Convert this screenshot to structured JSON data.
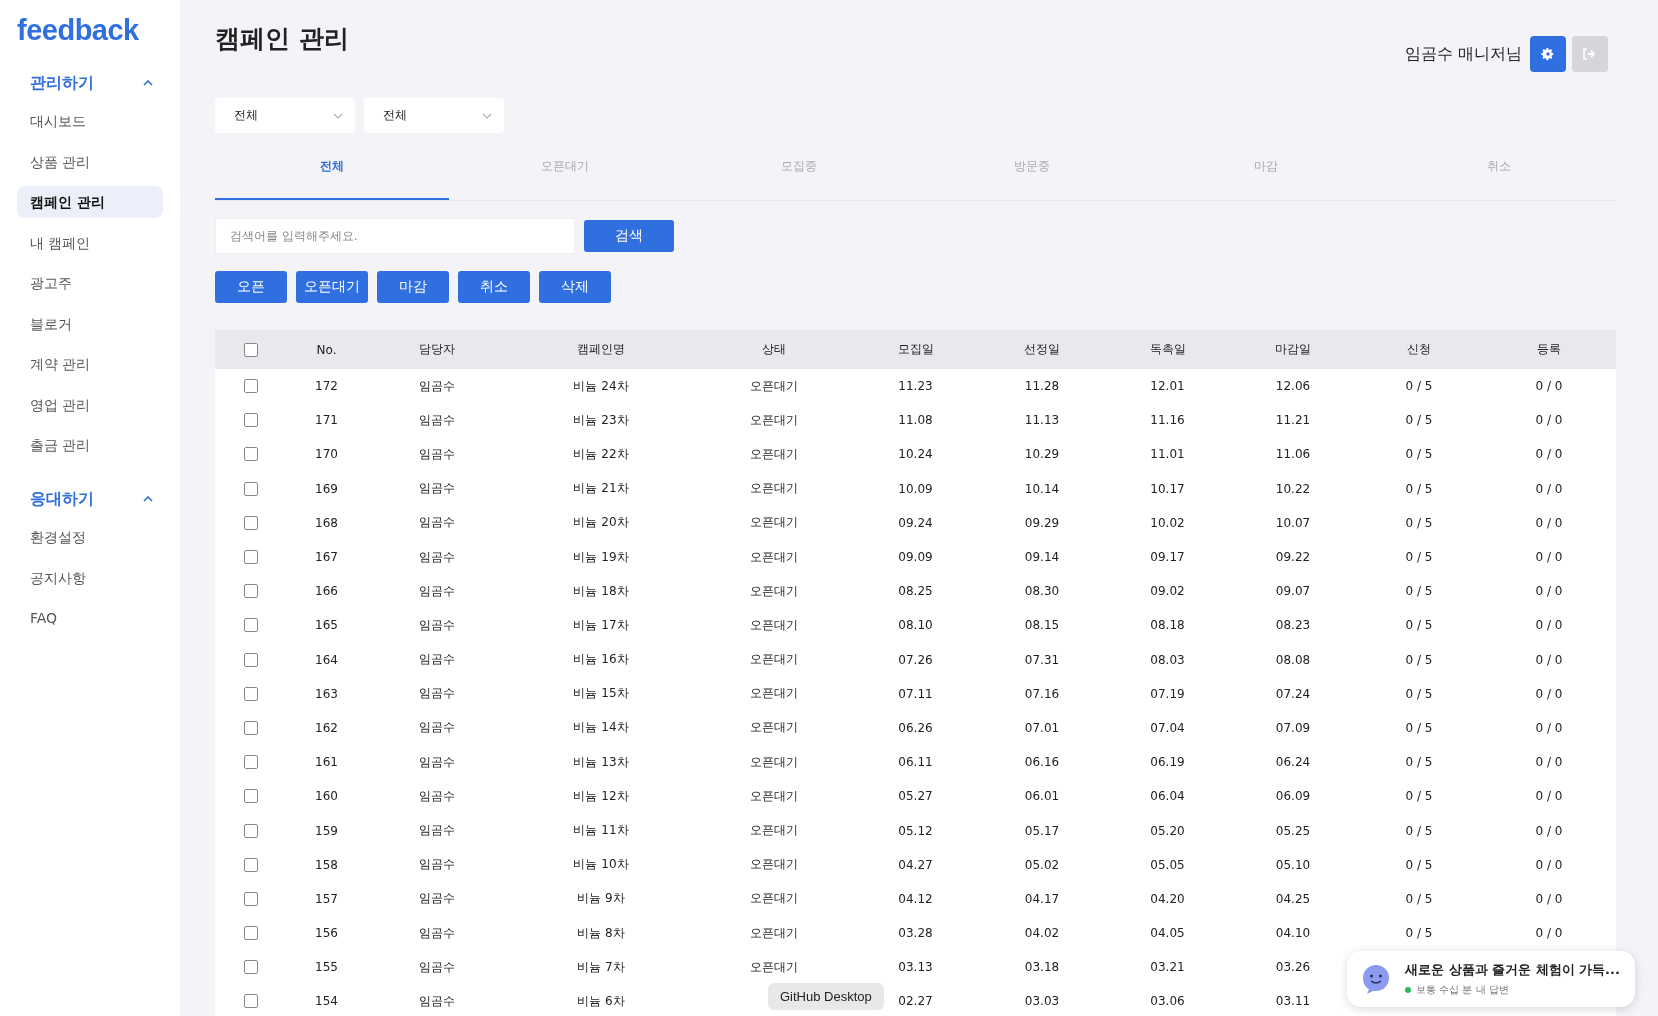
{
  "logo": "feedback",
  "sidebar": {
    "groups": [
      {
        "title": "관리하기",
        "expanded": true,
        "items": [
          {
            "label": "대시보드",
            "selected": false
          },
          {
            "label": "상품 관리",
            "selected": false
          },
          {
            "label": "캠페인 관리",
            "selected": true
          },
          {
            "label": "내 캠페인",
            "selected": false
          },
          {
            "label": "광고주",
            "selected": false
          },
          {
            "label": "블로거",
            "selected": false
          },
          {
            "label": "계약 관리",
            "selected": false
          },
          {
            "label": "영업 관리",
            "selected": false
          },
          {
            "label": "출금 관리",
            "selected": false
          }
        ]
      },
      {
        "title": "응대하기",
        "expanded": true,
        "items": [
          {
            "label": "환경설정",
            "selected": false
          },
          {
            "label": "공지사항",
            "selected": false
          },
          {
            "label": "FAQ",
            "selected": false
          }
        ]
      }
    ]
  },
  "page_title": "캠페인 관리",
  "user": {
    "name": "임곰수 매니저님"
  },
  "filters": [
    {
      "value": "전체"
    },
    {
      "value": "전체"
    }
  ],
  "tabs": [
    {
      "label": "전체",
      "selected": true
    },
    {
      "label": "오픈대기",
      "selected": false
    },
    {
      "label": "모집중",
      "selected": false
    },
    {
      "label": "방문중",
      "selected": false
    },
    {
      "label": "마감",
      "selected": false
    },
    {
      "label": "취소",
      "selected": false
    }
  ],
  "search": {
    "placeholder": "검색어를 입력해주세요.",
    "button": "검색"
  },
  "actions": [
    "오픈",
    "오픈대기",
    "마감",
    "취소",
    "삭제"
  ],
  "table": {
    "select_all": false,
    "columns": [
      "No.",
      "담당자",
      "캠페인명",
      "상태",
      "모집일",
      "선정일",
      "독촉일",
      "마감일",
      "신청",
      "등록"
    ],
    "rows": [
      {
        "checked": false,
        "cells": [
          "172",
          "임곰수",
          "비늄 24차",
          "오픈대기",
          "11.23",
          "11.28",
          "12.01",
          "12.06",
          "0 / 5",
          "0 / 0"
        ]
      },
      {
        "checked": false,
        "cells": [
          "171",
          "임곰수",
          "비늄 23차",
          "오픈대기",
          "11.08",
          "11.13",
          "11.16",
          "11.21",
          "0 / 5",
          "0 / 0"
        ]
      },
      {
        "checked": false,
        "cells": [
          "170",
          "임곰수",
          "비늄 22차",
          "오픈대기",
          "10.24",
          "10.29",
          "11.01",
          "11.06",
          "0 / 5",
          "0 / 0"
        ]
      },
      {
        "checked": false,
        "cells": [
          "169",
          "임곰수",
          "비늄 21차",
          "오픈대기",
          "10.09",
          "10.14",
          "10.17",
          "10.22",
          "0 / 5",
          "0 / 0"
        ]
      },
      {
        "checked": false,
        "cells": [
          "168",
          "임곰수",
          "비늄 20차",
          "오픈대기",
          "09.24",
          "09.29",
          "10.02",
          "10.07",
          "0 / 5",
          "0 / 0"
        ]
      },
      {
        "checked": false,
        "cells": [
          "167",
          "임곰수",
          "비늄 19차",
          "오픈대기",
          "09.09",
          "09.14",
          "09.17",
          "09.22",
          "0 / 5",
          "0 / 0"
        ]
      },
      {
        "checked": false,
        "cells": [
          "166",
          "임곰수",
          "비늄 18차",
          "오픈대기",
          "08.25",
          "08.30",
          "09.02",
          "09.07",
          "0 / 5",
          "0 / 0"
        ]
      },
      {
        "checked": false,
        "cells": [
          "165",
          "임곰수",
          "비늄 17차",
          "오픈대기",
          "08.10",
          "08.15",
          "08.18",
          "08.23",
          "0 / 5",
          "0 / 0"
        ]
      },
      {
        "checked": false,
        "cells": [
          "164",
          "임곰수",
          "비늄 16차",
          "오픈대기",
          "07.26",
          "07.31",
          "08.03",
          "08.08",
          "0 / 5",
          "0 / 0"
        ]
      },
      {
        "checked": false,
        "cells": [
          "163",
          "임곰수",
          "비늄 15차",
          "오픈대기",
          "07.11",
          "07.16",
          "07.19",
          "07.24",
          "0 / 5",
          "0 / 0"
        ]
      },
      {
        "checked": false,
        "cells": [
          "162",
          "임곰수",
          "비늄 14차",
          "오픈대기",
          "06.26",
          "07.01",
          "07.04",
          "07.09",
          "0 / 5",
          "0 / 0"
        ]
      },
      {
        "checked": false,
        "cells": [
          "161",
          "임곰수",
          "비늄 13차",
          "오픈대기",
          "06.11",
          "06.16",
          "06.19",
          "06.24",
          "0 / 5",
          "0 / 0"
        ]
      },
      {
        "checked": false,
        "cells": [
          "160",
          "임곰수",
          "비늄 12차",
          "오픈대기",
          "05.27",
          "06.01",
          "06.04",
          "06.09",
          "0 / 5",
          "0 / 0"
        ]
      },
      {
        "checked": false,
        "cells": [
          "159",
          "임곰수",
          "비늄 11차",
          "오픈대기",
          "05.12",
          "05.17",
          "05.20",
          "05.25",
          "0 / 5",
          "0 / 0"
        ]
      },
      {
        "checked": false,
        "cells": [
          "158",
          "임곰수",
          "비늄 10차",
          "오픈대기",
          "04.27",
          "05.02",
          "05.05",
          "05.10",
          "0 / 5",
          "0 / 0"
        ]
      },
      {
        "checked": false,
        "cells": [
          "157",
          "임곰수",
          "비늄 9차",
          "오픈대기",
          "04.12",
          "04.17",
          "04.20",
          "04.25",
          "0 / 5",
          "0 / 0"
        ]
      },
      {
        "checked": false,
        "cells": [
          "156",
          "임곰수",
          "비늄 8차",
          "오픈대기",
          "03.28",
          "04.02",
          "04.05",
          "04.10",
          "0 / 5",
          "0 / 0"
        ]
      },
      {
        "checked": false,
        "cells": [
          "155",
          "임곰수",
          "비늄 7차",
          "오픈대기",
          "03.13",
          "03.18",
          "03.21",
          "03.26"
        ]
      },
      {
        "checked": false,
        "cells": [
          "154",
          "임곰수",
          "비늄 6차",
          "",
          "02.27",
          "03.03",
          "03.06",
          "03.11"
        ]
      }
    ]
  },
  "tooltip": "GitHub Desktop",
  "chat_popup": {
    "message": "새로운 상품과 즐거운 체험이 가득...",
    "status": "보통 수십 분 내 답변"
  }
}
